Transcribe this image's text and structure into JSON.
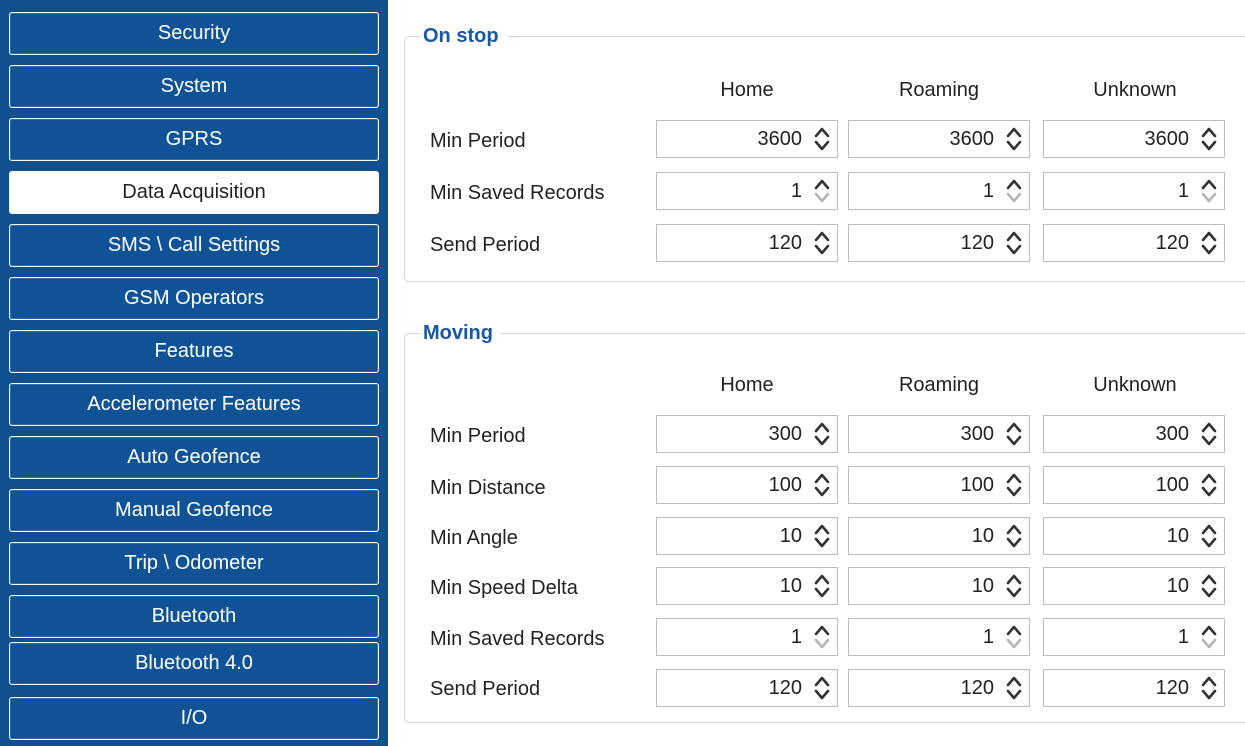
{
  "sidebar": {
    "items": [
      {
        "label": "Security"
      },
      {
        "label": "System"
      },
      {
        "label": "GPRS"
      },
      {
        "label": "Data Acquisition",
        "active": true
      },
      {
        "label": "SMS \\ Call Settings"
      },
      {
        "label": "GSM Operators"
      },
      {
        "label": "Features"
      },
      {
        "label": "Accelerometer Features"
      },
      {
        "label": "Auto Geofence"
      },
      {
        "label": "Manual Geofence"
      },
      {
        "label": "Trip \\ Odometer"
      },
      {
        "label": "Bluetooth"
      },
      {
        "label": "Bluetooth 4.0"
      },
      {
        "label": "I/O"
      }
    ]
  },
  "colors": {
    "sidebar_bg": "#10508e",
    "nav_button": "#0f5396",
    "group_title": "#1a58a3",
    "arrow_active": "#333333",
    "arrow_disabled": "#b5b5b5"
  },
  "on_stop": {
    "title": "On stop",
    "columns": [
      "Home",
      "Roaming",
      "Unknown"
    ],
    "rows": [
      {
        "label": "Min Period",
        "values": [
          "3600",
          "3600",
          "3600"
        ],
        "at_min": false
      },
      {
        "label": "Min Saved Records",
        "values": [
          "1",
          "1",
          "1"
        ],
        "at_min": true
      },
      {
        "label": "Send Period",
        "values": [
          "120",
          "120",
          "120"
        ],
        "at_min": false
      }
    ]
  },
  "moving": {
    "title": "Moving",
    "columns": [
      "Home",
      "Roaming",
      "Unknown"
    ],
    "rows": [
      {
        "label": "Min Period",
        "values": [
          "300",
          "300",
          "300"
        ],
        "at_min": false
      },
      {
        "label": "Min Distance",
        "values": [
          "100",
          "100",
          "100"
        ],
        "at_min": false
      },
      {
        "label": "Min Angle",
        "values": [
          "10",
          "10",
          "10"
        ],
        "at_min": false
      },
      {
        "label": "Min Speed Delta",
        "values": [
          "10",
          "10",
          "10"
        ],
        "at_min": false
      },
      {
        "label": "Min Saved Records",
        "values": [
          "1",
          "1",
          "1"
        ],
        "at_min": true
      },
      {
        "label": "Send Period",
        "values": [
          "120",
          "120",
          "120"
        ],
        "at_min": false
      }
    ]
  }
}
